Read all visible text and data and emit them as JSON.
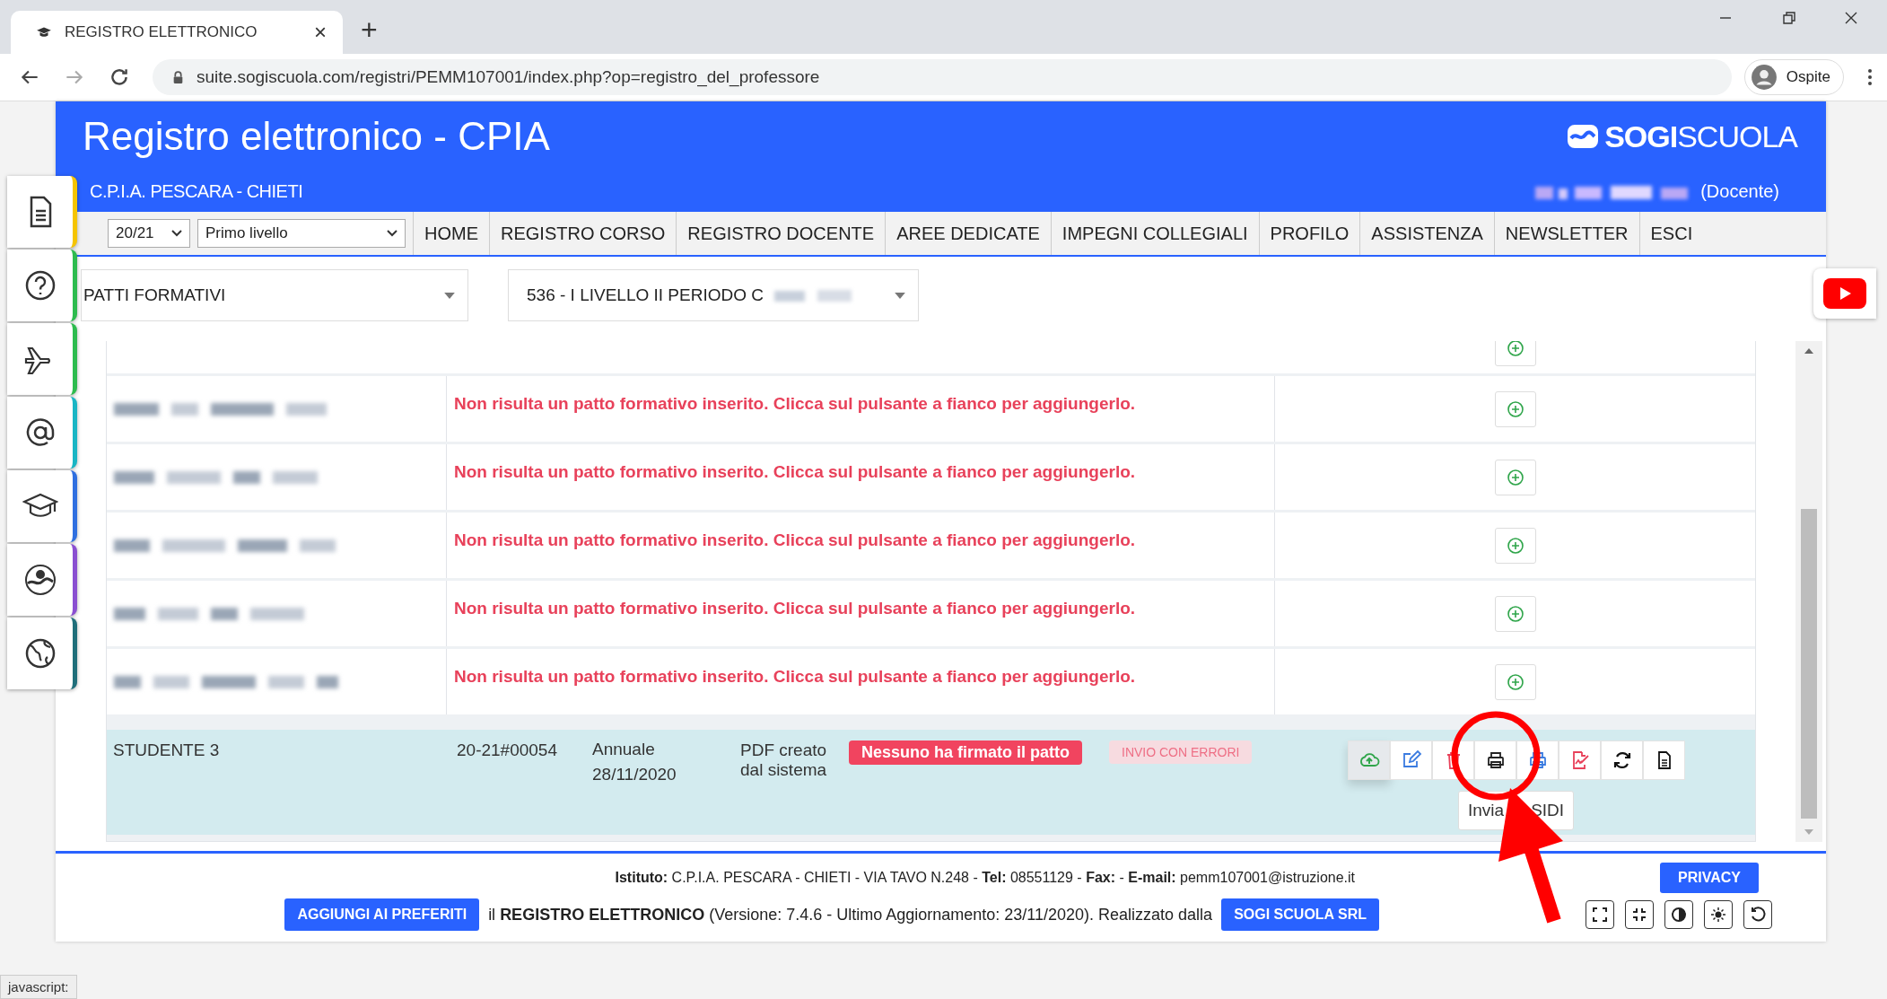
{
  "browser": {
    "tab_title": "REGISTRO ELETTRONICO",
    "tab_close": "×",
    "new_tab": "+",
    "url": "suite.sogiscuola.com/registri/PEMM107001/index.php?op=registro_del_professore",
    "profile": "Ospite",
    "status": "javascript:"
  },
  "header": {
    "title": "Registro elettronico - CPIA",
    "logo_bold": "SOGI",
    "logo_light": "SCUOLA",
    "school": "C.P.I.A. PESCARA - CHIETI",
    "role": "(Docente)"
  },
  "sidebar": [
    {
      "kind": "document",
      "color": "#f5c400"
    },
    {
      "kind": "help",
      "color": "#2dbb4e"
    },
    {
      "kind": "plane",
      "color": "#2dbb4e"
    },
    {
      "kind": "email",
      "color": "#19b5c4"
    },
    {
      "kind": "graduation",
      "color": "#2f6fe0"
    },
    {
      "kind": "badge",
      "color": "#8a4fd1"
    },
    {
      "kind": "globe",
      "color": "#1f6e7a"
    }
  ],
  "nav": {
    "year": "20/21",
    "level": "Primo livello",
    "items": [
      "HOME",
      "REGISTRO CORSO",
      "REGISTRO DOCENTE",
      "AREE DEDICATE",
      "IMPEGNI COLLEGIALI",
      "PROFILO",
      "ASSISTENZA",
      "NEWSLETTER",
      "ESCI"
    ]
  },
  "filters": {
    "section": "PATTI FORMATIVI",
    "class": "536 - I LIVELLO II PERIODO C"
  },
  "rows": [
    {
      "kind": "cut"
    },
    {
      "kind": "empty",
      "message": "Non risulta un patto formativo inserito. Clicca sul pulsante a fianco per aggiungerlo."
    },
    {
      "kind": "empty",
      "message": "Non risulta un patto formativo inserito. Clicca sul pulsante a fianco per aggiungerlo."
    },
    {
      "kind": "empty",
      "message": "Non risulta un patto formativo inserito. Clicca sul pulsante a fianco per aggiungerlo."
    },
    {
      "kind": "empty",
      "message": "Non risulta un patto formativo inserito. Clicca sul pulsante a fianco per aggiungerlo."
    },
    {
      "kind": "empty",
      "message": "Non risulta un patto formativo inserito. Clicca sul pulsante a fianco per aggiungerlo."
    },
    {
      "kind": "student",
      "name": "STUDENTE 3",
      "code": "20-21#00054",
      "period": "Annuale",
      "date": "28/11/2020",
      "pdf": "PDF creato dal sistema",
      "signature": "Nessuno ha firmato il patto",
      "send_status": "INVIO CON ERRORI",
      "actions": [
        {
          "kind": "upload",
          "hovered": true
        },
        {
          "kind": "edit",
          "hovered": false
        },
        {
          "kind": "delete",
          "hovered": false
        },
        {
          "kind": "print",
          "hovered": false
        },
        {
          "kind": "reprint",
          "hovered": false
        },
        {
          "kind": "sign",
          "hovered": false
        },
        {
          "kind": "refresh",
          "hovered": false
        },
        {
          "kind": "file",
          "hovered": false
        }
      ],
      "tooltip": [
        "Invia",
        "SIDI"
      ]
    }
  ],
  "footer": {
    "info": "**Istituto:** C.P.I.A. PESCARA - CHIETI - VIA TAVO N.248 - **Tel:** 08551129 - **Fax:** - **E-mail:** pemm107001@istruzione.it",
    "favorites": "AGGIUNGI AI PREFERITI",
    "version": "il **REGISTRO ELETTRONICO** (Versione: 7.4.6 - Ultimo Aggiornamento: 23/11/2020). Realizzato dalla",
    "company": "SOGI SCUOLA SRL",
    "privacy": "PRIVACY",
    "tools": [
      {
        "kind": "expand"
      },
      {
        "kind": "compress"
      },
      {
        "kind": "contrast"
      },
      {
        "kind": "brightness"
      },
      {
        "kind": "reset"
      }
    ]
  }
}
